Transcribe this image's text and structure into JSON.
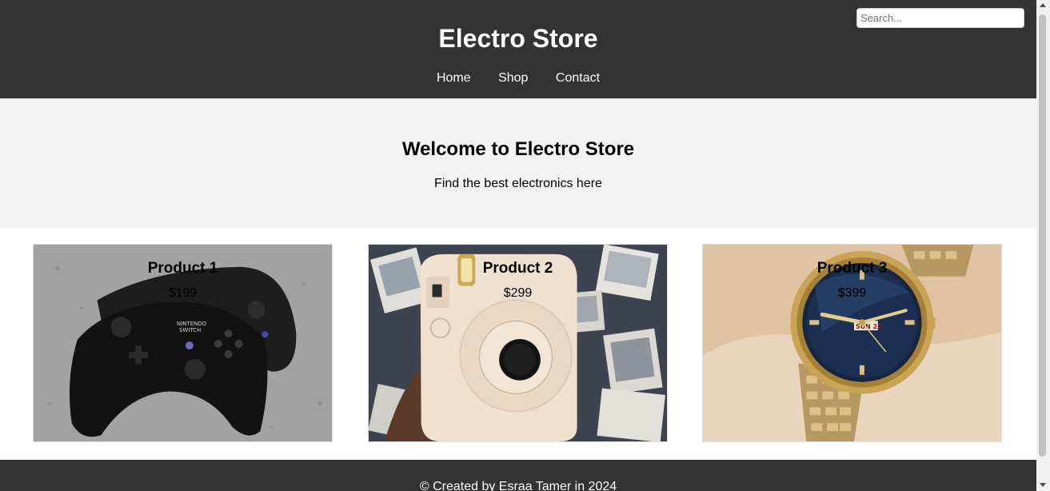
{
  "header": {
    "title": "Electro Store",
    "search_placeholder": "Search...",
    "search_value": "",
    "nav": [
      {
        "label": "Home"
      },
      {
        "label": "Shop"
      },
      {
        "label": "Contact"
      }
    ]
  },
  "hero": {
    "heading": "Welcome to Electro Store",
    "subheading": "Find the best electronics here"
  },
  "products": [
    {
      "name": "Product 1",
      "price": "$199",
      "image": "game-controllers-image"
    },
    {
      "name": "Product 2",
      "price": "$299",
      "image": "instant-camera-image"
    },
    {
      "name": "Product 3",
      "price": "$399",
      "image": "wristwatch-image"
    }
  ],
  "footer": {
    "text": "© Created by Esraa Tamer in 2024"
  },
  "colors": {
    "header_bg": "#333333",
    "hero_bg": "#f2f2f2",
    "footer_bg": "#333333",
    "text_light": "#ffffff"
  }
}
